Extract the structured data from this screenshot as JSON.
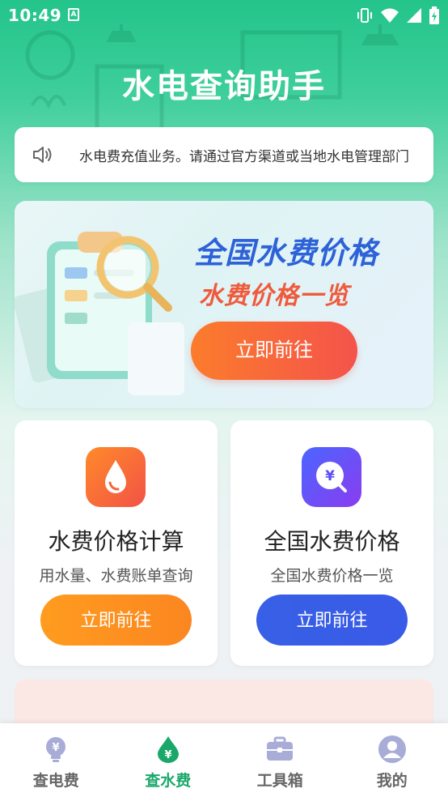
{
  "status_bar": {
    "time": "10:49",
    "a_badge": "A"
  },
  "app": {
    "title": "水电查询助手"
  },
  "notice": {
    "icon": "speaker-icon",
    "text": "水电费充值业务。请通过官方渠道或当地水电管理部门"
  },
  "banner": {
    "title": "全国水费价格",
    "subtitle": "水费价格一览",
    "button": "立即前往",
    "colors": {
      "title": "#2d62d8",
      "subtitle": "#ef5a3c"
    }
  },
  "cards": [
    {
      "icon": "water-drop-icon",
      "title": "水费价格计算",
      "subtitle": "用水量、水费账单查询",
      "button": "立即前往"
    },
    {
      "icon": "yuan-search-icon",
      "title": "全国水费价格",
      "subtitle": "全国水费价格一览",
      "button": "立即前往"
    }
  ],
  "tabs": [
    {
      "label": "查电费",
      "icon": "bulb-yuan-icon",
      "active": false
    },
    {
      "label": "查水费",
      "icon": "drop-yuan-icon",
      "active": true
    },
    {
      "label": "工具箱",
      "icon": "toolbox-icon",
      "active": false
    },
    {
      "label": "我的",
      "icon": "person-icon",
      "active": false
    }
  ],
  "accent_color": "#1aa86a"
}
